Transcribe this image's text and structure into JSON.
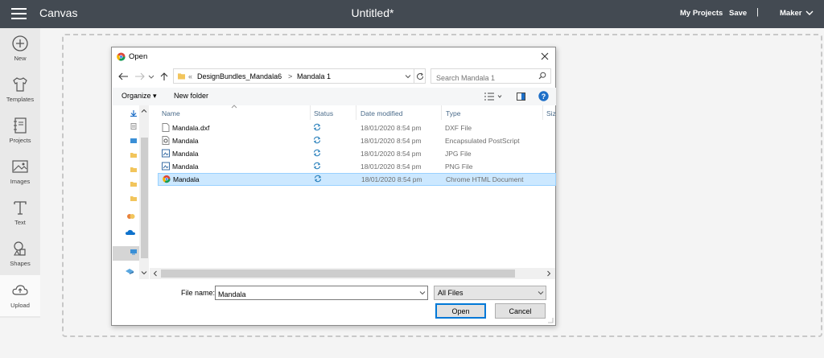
{
  "app": {
    "title": "Canvas",
    "document_title": "Untitled*",
    "nav": {
      "my_projects": "My Projects",
      "save": "Save",
      "separator": "|",
      "machine": "Maker"
    }
  },
  "sidebar": {
    "items": [
      {
        "label": "New",
        "icon": "plus-circle-icon"
      },
      {
        "label": "Templates",
        "icon": "shirt-icon"
      },
      {
        "label": "Projects",
        "icon": "notebook-icon"
      },
      {
        "label": "Images",
        "icon": "image-icon"
      },
      {
        "label": "Text",
        "icon": "text-t-icon"
      },
      {
        "label": "Shapes",
        "icon": "shapes-icon"
      },
      {
        "label": "Upload",
        "icon": "cloud-upload-icon"
      }
    ]
  },
  "dialog": {
    "title": "Open",
    "breadcrumb": {
      "overflow": "«",
      "folder": "DesignBundles_Mandala6",
      "arrow": ">",
      "subfolder": "Mandala 1"
    },
    "search_placeholder": "Search Mandala 1",
    "toolbar": {
      "organize": "Organize ▾",
      "new_folder": "New folder"
    },
    "columns": {
      "name": "Name",
      "status": "Status",
      "date": "Date modified",
      "type": "Type",
      "size": "Siz"
    },
    "files": [
      {
        "name": "Mandala.dxf",
        "date": "18/01/2020 8:54 pm",
        "type": "DXF File",
        "icon": "document-icon"
      },
      {
        "name": "Mandala",
        "date": "18/01/2020 8:54 pm",
        "type": "Encapsulated PostScript",
        "icon": "eps-icon"
      },
      {
        "name": "Mandala",
        "date": "18/01/2020 8:54 pm",
        "type": "JPG File",
        "icon": "image-file-icon"
      },
      {
        "name": "Mandala",
        "date": "18/01/2020 8:54 pm",
        "type": "PNG File",
        "icon": "image-file-icon"
      },
      {
        "name": "Mandala",
        "date": "18/01/2020 8:54 pm",
        "type": "Chrome HTML Document",
        "icon": "chrome-icon"
      }
    ],
    "file_name_label": "File name:",
    "file_name_value": "Mandala",
    "filter": "All Files",
    "open_label": "Open",
    "cancel_label": "Cancel"
  },
  "colors": {
    "topbar": "#434a52",
    "selection": "#cce8ff",
    "sync_status": "#1f7ab8",
    "folder": "#f2c55c",
    "help": "#1e6fc7"
  }
}
